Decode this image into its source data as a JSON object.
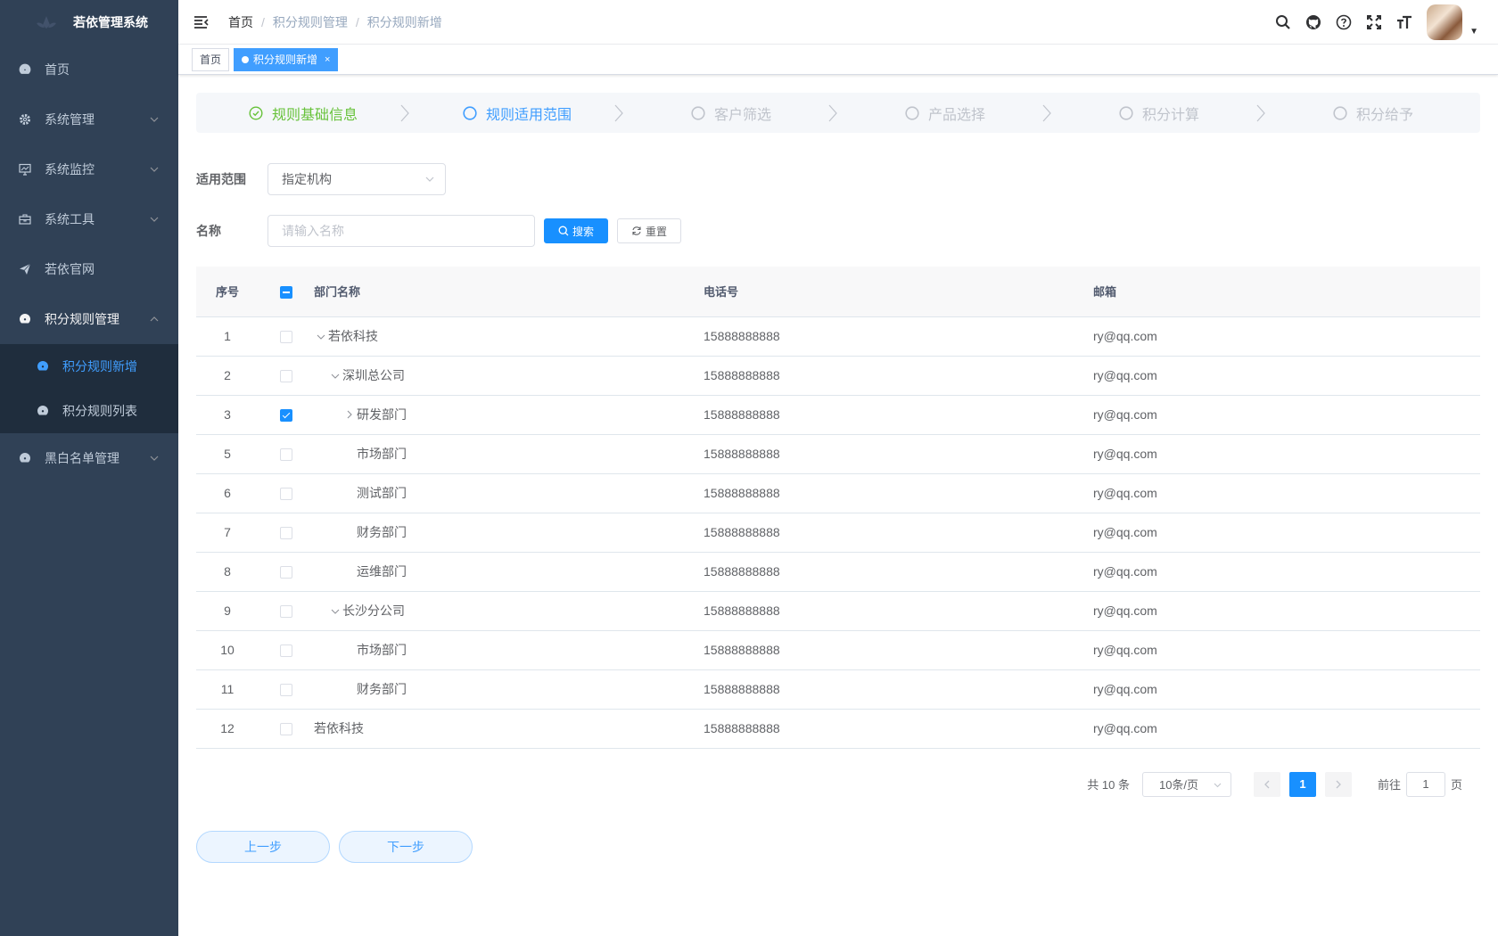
{
  "app": {
    "title": "若依管理系统"
  },
  "sidebar": {
    "items": [
      {
        "label": "首页",
        "icon": "dashboard-icon"
      },
      {
        "label": "系统管理",
        "icon": "gear-icon",
        "has_children": true
      },
      {
        "label": "系统监控",
        "icon": "monitor-icon",
        "has_children": true
      },
      {
        "label": "系统工具",
        "icon": "toolbox-icon",
        "has_children": true
      },
      {
        "label": "若依官网",
        "icon": "send-icon"
      },
      {
        "label": "积分规则管理",
        "icon": "dashboard-icon",
        "has_children": true,
        "open": true,
        "children": [
          {
            "label": "积分规则新增",
            "active": true
          },
          {
            "label": "积分规则列表"
          }
        ]
      },
      {
        "label": "黑白名单管理",
        "icon": "dashboard-icon",
        "has_children": true
      }
    ]
  },
  "navbar": {
    "breadcrumb": [
      "首页",
      "积分规则管理",
      "积分规则新增"
    ],
    "icons": [
      "search-icon",
      "github-icon",
      "question-icon",
      "fullscreen-icon",
      "font-size-icon"
    ]
  },
  "tags": [
    {
      "label": "首页",
      "active": false
    },
    {
      "label": "积分规则新增",
      "active": true,
      "close": "×"
    }
  ],
  "steps": [
    {
      "label": "规则基础信息",
      "status": "success"
    },
    {
      "label": "规则适用范围",
      "status": "process"
    },
    {
      "label": "客户筛选",
      "status": "wait"
    },
    {
      "label": "产品选择",
      "status": "wait"
    },
    {
      "label": "积分计算",
      "status": "wait"
    },
    {
      "label": "积分给予",
      "status": "wait"
    }
  ],
  "form": {
    "scope_label": "适用范围",
    "scope_value": "指定机构",
    "name_label": "名称",
    "name_placeholder": "请输入名称",
    "name_value": "",
    "search_label": "搜索",
    "reset_label": "重置"
  },
  "table": {
    "headers": {
      "index": "序号",
      "name": "部门名称",
      "phone": "电话号",
      "email": "邮箱"
    },
    "header_checkbox": "indeterminate",
    "rows": [
      {
        "index": "1",
        "name": "若依科技",
        "phone": "15888888888",
        "email": "ry@qq.com",
        "level": 0,
        "arrow": "down",
        "checked": false
      },
      {
        "index": "2",
        "name": "深圳总公司",
        "phone": "15888888888",
        "email": "ry@qq.com",
        "level": 1,
        "arrow": "down",
        "checked": false
      },
      {
        "index": "3",
        "name": "研发部门",
        "phone": "15888888888",
        "email": "ry@qq.com",
        "level": 2,
        "arrow": "right",
        "checked": true
      },
      {
        "index": "5",
        "name": "市场部门",
        "phone": "15888888888",
        "email": "ry@qq.com",
        "level": 2,
        "arrow": "none",
        "checked": false
      },
      {
        "index": "6",
        "name": "测试部门",
        "phone": "15888888888",
        "email": "ry@qq.com",
        "level": 2,
        "arrow": "none",
        "checked": false
      },
      {
        "index": "7",
        "name": "财务部门",
        "phone": "15888888888",
        "email": "ry@qq.com",
        "level": 2,
        "arrow": "none",
        "checked": false
      },
      {
        "index": "8",
        "name": "运维部门",
        "phone": "15888888888",
        "email": "ry@qq.com",
        "level": 2,
        "arrow": "none",
        "checked": false
      },
      {
        "index": "9",
        "name": "长沙分公司",
        "phone": "15888888888",
        "email": "ry@qq.com",
        "level": 1,
        "arrow": "down",
        "checked": false
      },
      {
        "index": "10",
        "name": "市场部门",
        "phone": "15888888888",
        "email": "ry@qq.com",
        "level": 2,
        "arrow": "none",
        "checked": false
      },
      {
        "index": "11",
        "name": "财务部门",
        "phone": "15888888888",
        "email": "ry@qq.com",
        "level": 2,
        "arrow": "none",
        "checked": false
      },
      {
        "index": "12",
        "name": "若依科技",
        "phone": "15888888888",
        "email": "ry@qq.com",
        "level": 0,
        "arrow": "leaf",
        "checked": false
      }
    ]
  },
  "pagination": {
    "total_text": "共 10 条",
    "page_size": "10条/页",
    "current_page": "1",
    "goto_prefix": "前往",
    "goto_value": "1",
    "goto_suffix": "页"
  },
  "actions": {
    "prev_label": "上一步",
    "next_label": "下一步"
  },
  "colors": {
    "sidebar_bg": "#304156",
    "submenu_bg": "#1f2d3d",
    "primary": "#1890ff",
    "success": "#67c23a"
  }
}
